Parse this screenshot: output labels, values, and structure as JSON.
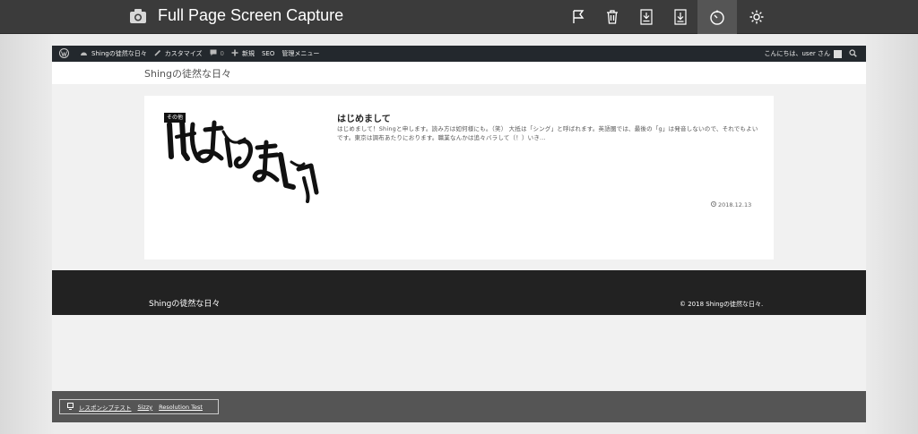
{
  "extension": {
    "title": "Full Page Screen Capture",
    "icons": [
      "camera-icon",
      "flag-icon",
      "trash-icon",
      "pdf-download-icon",
      "download-icon",
      "timer-icon",
      "settings-icon"
    ]
  },
  "admin_bar": {
    "site_name": "Shingの徒然な日々",
    "customize": "カスタマイズ",
    "comments_count": "0",
    "new": "新規",
    "seo": "SEO",
    "admin_menu": "管理メニュー",
    "greeting": "こんにちは、user さん"
  },
  "site": {
    "title": "Shingの徒然な日々"
  },
  "post": {
    "category": "その他",
    "title": "はじめまして",
    "excerpt": "はじめまして！Shingと申します。読み方は如何様にも。（笑） 大抵は「シング」と呼ばれます。英語圏では、最後の「g」は発音しないので、それでもよいです。東京は調布あたりにおります。職業なんかは追々バラして（！）いき...",
    "date": "2018.12.13",
    "thumbnail_alt": "はじめまして"
  },
  "footer": {
    "title": "Shingの徒然な日々",
    "copyright": "© 2018 Shingの徒然な日々."
  },
  "test_bar": {
    "links": [
      "レスポンシブテスト",
      "Sizzy",
      "Resolution Test"
    ]
  }
}
